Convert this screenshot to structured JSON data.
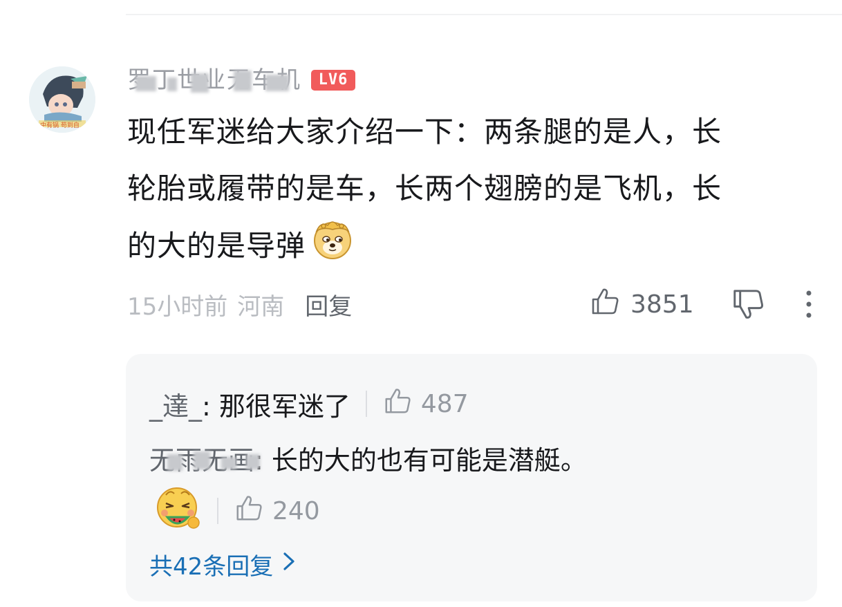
{
  "comment": {
    "username": "罗丁世业无车机",
    "level": "LV6",
    "text_lines": [
      "现任军迷给大家介绍一下：两条腿的是人，长",
      "轮胎或履带的是车，长两个翅膀的是飞机，长",
      "的大的是导弹"
    ],
    "emote_name": "doge-emote",
    "time": "15小时前",
    "location": "河南",
    "reply_label": "回复",
    "like_count": "3851"
  },
  "replies": [
    {
      "author": "_達_",
      "text": ": 那很军迷了",
      "like_count": "487"
    },
    {
      "author": "无雨无画",
      "text": ": 长的大的也有可能是潜艇。",
      "emote_name": "watermelon-eating-emote",
      "like_count": "240"
    }
  ],
  "more_replies_label": "共42条回复",
  "colors": {
    "level_badge": "#f15b5b",
    "link": "#1a6fb5",
    "reply_box_bg": "#f6f7f8"
  }
}
